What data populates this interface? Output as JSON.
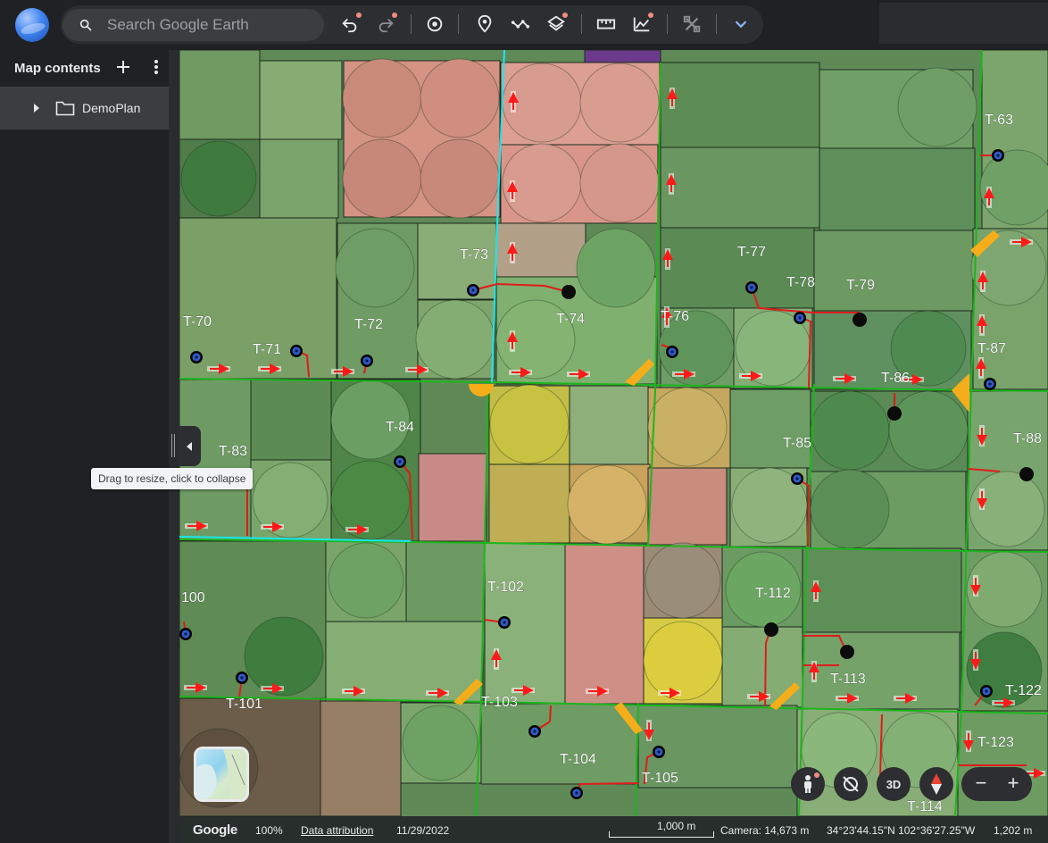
{
  "search": {
    "placeholder": "Search Google Earth"
  },
  "toolbar": {
    "icons": [
      "undo-icon",
      "redo-icon",
      "history-icon",
      "add-placemark-icon",
      "add-path-icon",
      "layers-icon",
      "measure-icon",
      "elevation-icon",
      "settings-icon",
      "chevron-down-icon"
    ]
  },
  "sidebar": {
    "title": "Map contents",
    "items": [
      {
        "label": "DemoPlan"
      }
    ]
  },
  "tooltip": {
    "text": "Drag to resize, click to collapse"
  },
  "map": {
    "labels": [
      "T-63",
      "T-70",
      "T-71",
      "T-72",
      "T-73",
      "T-74",
      "T-76",
      "T-77",
      "T-78",
      "T-79",
      "T-83",
      "T-84",
      "T-85",
      "T-86",
      "T-87",
      "T-88",
      "100",
      "T-101",
      "T-102",
      "T-103",
      "T-104",
      "T-105",
      "T-112",
      "T-113",
      "T-114",
      "T-122",
      "T-123"
    ]
  },
  "controls": {
    "three_d_label": "3D",
    "zoom_out": "−",
    "zoom_in": "+"
  },
  "status": {
    "brand": "Google",
    "zoom": "100%",
    "attribution": "Data attribution",
    "date": "11/29/2022",
    "scale": "1,000 m",
    "camera": "Camera: 14,673 m",
    "coords": "34°23'44.15\"N 102°36'27.25\"W",
    "elevation": "1,202 m"
  },
  "colors": {
    "accent": "#8ab4f8",
    "field_red": "#d98c7c",
    "field_yellow": "#d6c64a",
    "road_green": "#1db51d",
    "road_cyan": "#19e6f0"
  }
}
